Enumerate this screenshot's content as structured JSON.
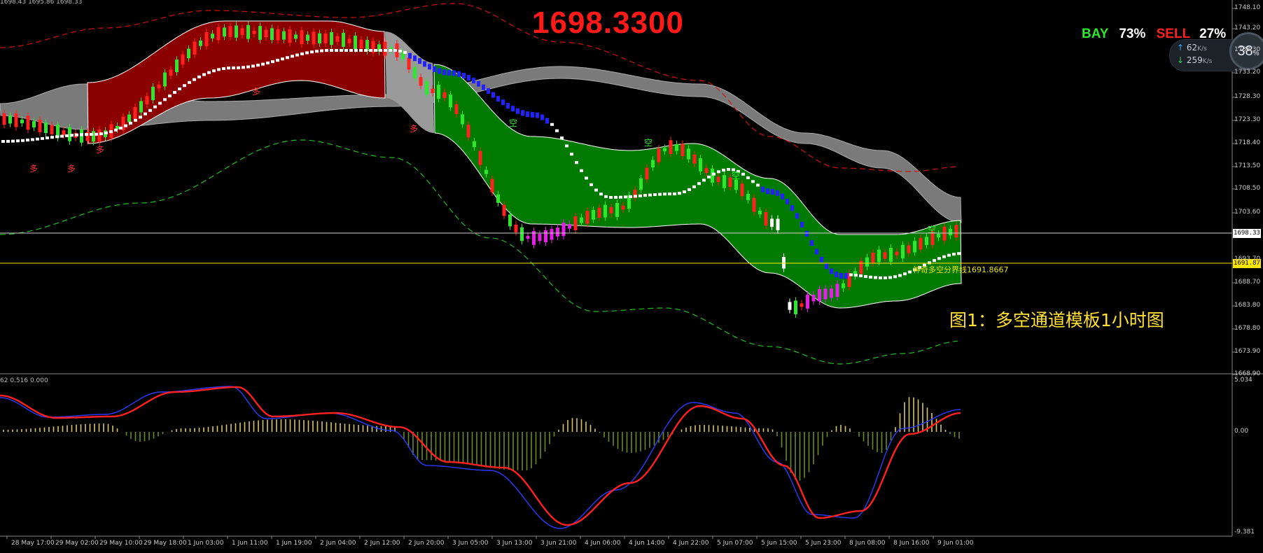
{
  "header": {
    "ohlc_text": "1698.43 1695.86 1698.33",
    "big_price": "1698.3300"
  },
  "sentiment": {
    "bay_label": "BAY",
    "bay_pct": "73%",
    "sell_label": "SELL",
    "sell_pct": "27%"
  },
  "net_widget": {
    "upload": "62",
    "download": "259",
    "unit": "K/s",
    "gauge_value": "38",
    "gauge_unit": "%"
  },
  "price_axis": [
    "1748.10",
    "1743.20",
    "1738.30",
    "1733.20",
    "1728.30",
    "1723.30",
    "1718.40",
    "1713.50",
    "1708.50",
    "1703.60",
    "1698.33",
    "1693.70",
    "1691.87",
    "1688.70",
    "1683.80",
    "1678.80",
    "1673.90",
    "1668.90"
  ],
  "price_tags": {
    "current": "1698.33",
    "level": "1691.87"
  },
  "level_line_text": "神奇多空分界线1691.8667",
  "caption": "图1：多空通道模板1小时图",
  "indicator": {
    "values_text": "62 0.516 0.000",
    "axis": [
      "5.034",
      "0.00",
      "-9.381"
    ]
  },
  "time_axis": [
    "28 May 17:00",
    "29 May 02:00",
    "29 May 10:00",
    "29 May 18:00",
    "1 Jun 03:00",
    "1 Jun 11:00",
    "1 Jun 19:00",
    "2 Jun 04:00",
    "2 Jun 12:00",
    "2 Jun 20:00",
    "3 Jun 05:00",
    "3 Jun 13:00",
    "3 Jun 21:00",
    "4 Jun 06:00",
    "4 Jun 14:00",
    "4 Jun 22:00",
    "5 Jun 07:00",
    "5 Jun 15:00",
    "5 Jun 23:00",
    "8 Jun 08:00",
    "8 Jun 16:00",
    "9 Jun 01:00"
  ],
  "signals": {
    "buy": "多",
    "sell": "空"
  },
  "colors": {
    "background": "#000000",
    "up_candle": "#ff2020",
    "down_candle": "#2ee62e",
    "channel_bull": "#8b0000",
    "channel_bear": "#007a00",
    "channel_gray": "#6e6e6e",
    "macd_main": "#ff2020",
    "macd_signal": "#2b3bff",
    "level_line": "#ffe600"
  }
}
